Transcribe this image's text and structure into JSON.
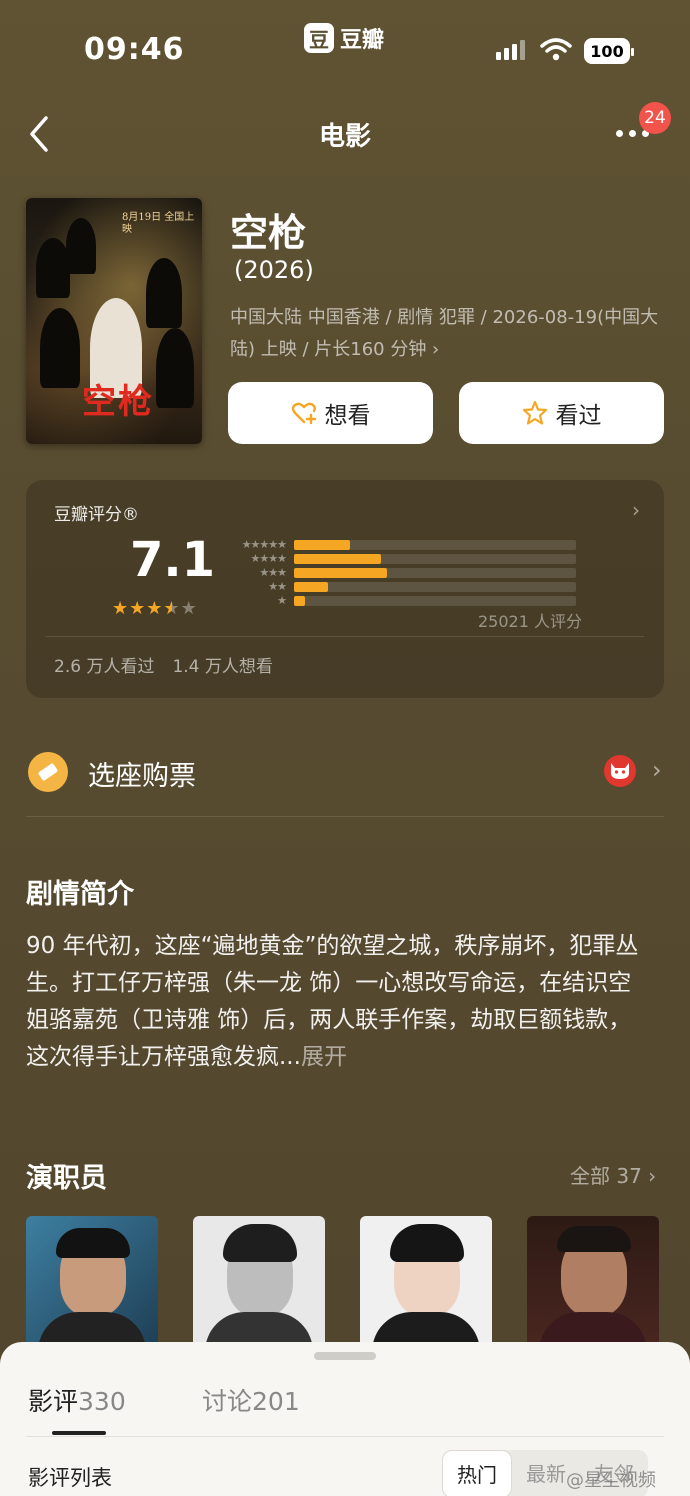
{
  "status_bar": {
    "time": "09:46",
    "app_logo_char": "豆",
    "app_name": "豆瓣",
    "battery": "100"
  },
  "nav": {
    "title": "电影",
    "notification_count": "24"
  },
  "movie": {
    "title": "空枪",
    "year": "(2026)",
    "meta": "中国大陆 中国香港 / 剧情 犯罪 / 2026-08-19(中国大陆) 上映 / 片长160 分钟 ›",
    "poster_date": "8月19日 全国上映",
    "poster_title": "空枪",
    "want_label": "想看",
    "seen_label": "看过"
  },
  "rating": {
    "label": "豆瓣评分®",
    "score": "7.1",
    "stars": 3.5,
    "distribution": [
      {
        "stars": "★★★★★",
        "fraction": 0.2
      },
      {
        "stars": "★★★★",
        "fraction": 0.31
      },
      {
        "stars": "★★★",
        "fraction": 0.33
      },
      {
        "stars": "★★",
        "fraction": 0.12
      },
      {
        "stars": "★",
        "fraction": 0.04
      }
    ],
    "count_text": "25021 人评分",
    "seen_text": "2.6 万人看过",
    "want_text": "1.4 万人想看"
  },
  "tickets": {
    "label": "选座购票"
  },
  "synopsis": {
    "title": "剧情简介",
    "text": "90 年代初，这座“遍地黄金”的欲望之城，秩序崩坏，犯罪丛生。打工仔万梓强（朱一龙 饰）一心想改写命运，在结识空姐骆嘉苑（卫诗雅 饰）后，两人联手作案，劫取巨额钱款，这次得手让万梓强愈发疯...",
    "expand": "展开"
  },
  "cast": {
    "title": "演职员",
    "all_label": "全部 37 ›"
  },
  "sheet": {
    "tab_reviews": "影评",
    "tab_reviews_count": "330",
    "tab_discuss": "讨论",
    "tab_discuss_count": "201",
    "list_label": "影评列表",
    "sort_hot": "热门",
    "sort_new": "最新",
    "sort_friends": "友邻",
    "watermark": "@星尘视频"
  },
  "colors": {
    "background": "#574b30",
    "accent_star": "#f5a623",
    "badge_red": "#f2544b"
  }
}
